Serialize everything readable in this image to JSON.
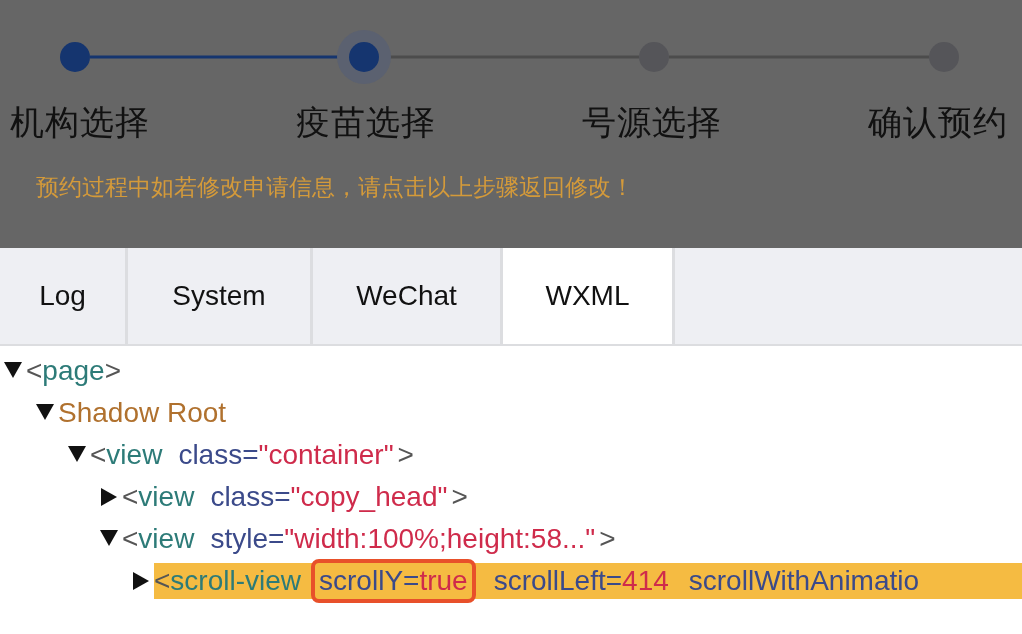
{
  "steps": [
    {
      "label": "机构选择",
      "reached": true,
      "current": false
    },
    {
      "label": "疫苗选择",
      "reached": true,
      "current": true
    },
    {
      "label": "号源选择",
      "reached": false,
      "current": false
    },
    {
      "label": "确认预约",
      "reached": false,
      "current": false
    }
  ],
  "notice": "预约过程中如若修改申请信息，请点击以上步骤返回修改！",
  "tabs": [
    {
      "label": "Log",
      "selected": false
    },
    {
      "label": "System",
      "selected": false
    },
    {
      "label": "WeChat",
      "selected": false
    },
    {
      "label": "WXML",
      "selected": true
    }
  ],
  "tree": [
    {
      "kind": "tag",
      "open": "<",
      "tag": "page",
      "close": ">",
      "expanded": true,
      "selected": false,
      "children": [
        {
          "kind": "root",
          "label": "Shadow Root",
          "expanded": true,
          "selected": false,
          "children": [
            {
              "kind": "tag",
              "open": "<",
              "tag": "view",
              "attrs": [
                {
                  "name": "class=",
                  "value": "\"container\"",
                  "outlined": false
                }
              ],
              "close": ">",
              "expanded": true,
              "selected": false,
              "children": [
                {
                  "kind": "tag",
                  "open": "<",
                  "tag": "view",
                  "attrs": [
                    {
                      "name": "class=",
                      "value": "\"copy_head\"",
                      "outlined": false
                    }
                  ],
                  "close": ">",
                  "expanded": false,
                  "selected": false
                },
                {
                  "kind": "tag",
                  "open": "<",
                  "tag": "view",
                  "attrs": [
                    {
                      "name": "style=",
                      "value": "\"width:100%;height:58...\"",
                      "outlined": false
                    }
                  ],
                  "close": ">",
                  "expanded": true,
                  "selected": false,
                  "children": [
                    {
                      "kind": "tag",
                      "open": "<",
                      "tag": "scroll-view",
                      "attrs": [
                        {
                          "name": "scrollY=",
                          "value": "true",
                          "outlined": true
                        },
                        {
                          "name": "scrollLeft=",
                          "value": "414",
                          "outlined": false
                        },
                        {
                          "name": "scrollWithAnimatio",
                          "outlined": false
                        }
                      ],
                      "expanded": false,
                      "selected": true
                    }
                  ]
                }
              ]
            }
          ]
        }
      ]
    }
  ]
}
